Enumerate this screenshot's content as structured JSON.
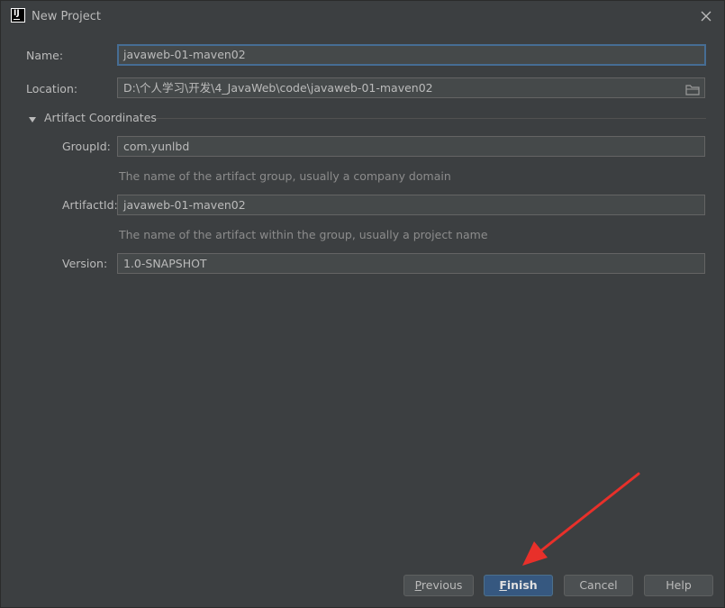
{
  "window": {
    "title": "New Project",
    "app_icon_text": "IJ"
  },
  "form": {
    "name": {
      "label": "Name:",
      "value": "javaweb-01-maven02"
    },
    "location": {
      "label": "Location:",
      "value": "D:\\个人学习\\开发\\4_JavaWeb\\code\\javaweb-01-maven02"
    },
    "artifact_section": {
      "title": "Artifact Coordinates",
      "expanded": true,
      "group_id": {
        "label": "GroupId:",
        "value": "com.yunlbd",
        "hint": "The name of the artifact group, usually a company domain"
      },
      "artifact_id": {
        "label": "ArtifactId:",
        "value": "javaweb-01-maven02",
        "hint": "The name of the artifact within the group, usually a project name"
      },
      "version": {
        "label": "Version:",
        "value": "1.0-SNAPSHOT"
      }
    }
  },
  "buttons": {
    "previous": {
      "mnemonic": "P",
      "rest": "revious"
    },
    "finish": {
      "mnemonic": "F",
      "rest": "inish"
    },
    "cancel": "Cancel",
    "help": "Help"
  },
  "annotation": {
    "color": "#e8302a"
  },
  "colors": {
    "background": "#3c3f41",
    "field_bg": "#45494a",
    "focus_border": "#466d94",
    "default_button": "#365880"
  }
}
